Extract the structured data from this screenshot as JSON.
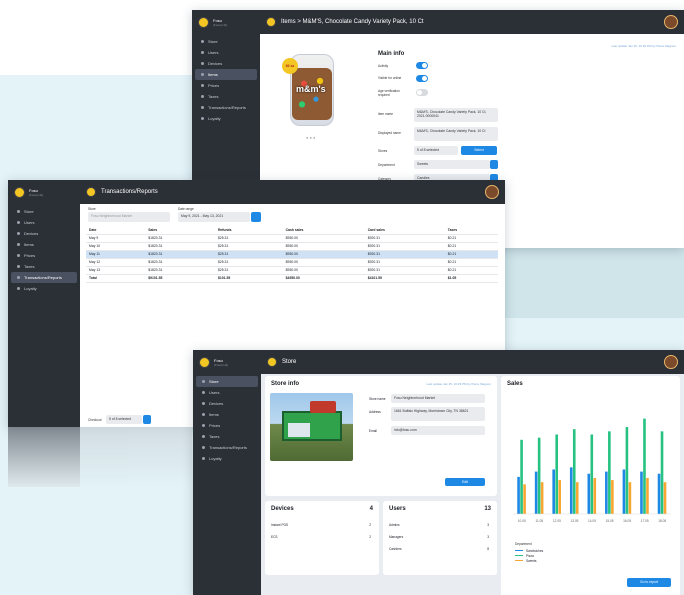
{
  "brand": {
    "name": "Fosu",
    "subtitle": "(Fosu) HQ"
  },
  "nav_item_window": {
    "items": [
      "Store",
      "Users",
      "Devices",
      "Items",
      "Prices",
      "Taxes",
      "Transactions/Reports",
      "Loyalty"
    ]
  },
  "nav_tx_window": {
    "items": [
      "Store",
      "Users",
      "Devices",
      "Items",
      "Prices",
      "Taxes",
      "Transactions/Reports",
      "Loyalty"
    ]
  },
  "nav_store_window": {
    "items": [
      "Store",
      "Users",
      "Devices",
      "Items",
      "Prices",
      "Taxes",
      "Transactions/Reports",
      "Loyalty"
    ]
  },
  "item_window": {
    "title": "Items > M&M'S, Chocolate Candy Variety Pack, 10 Ct",
    "last_update": "Last update Jan 25, 10:29 PM by Pierre Magnon",
    "section": "Main info",
    "labels": {
      "activity": "Activity",
      "visible": "Visible for online",
      "age": "Age verification required",
      "item_name": "Item name",
      "displayed_name": "Displayed name",
      "stores": "Stores",
      "department": "Department",
      "category": "Category"
    },
    "values": {
      "item_name": "M&M'S, Chocolate Candy Variety Pack, 10 Ct, 2021-0000041",
      "displayed_name": "M&M'S, Chocolate Candy Variety Pack, 10 Ct",
      "stores": "5 of 8 selected",
      "department": "Sweets",
      "category": "Candies"
    },
    "select_btn": "Select",
    "product_badge": "62 oz",
    "product_label": "m&m's"
  },
  "tx_window": {
    "title": "Transactions/Reports",
    "store_label": "Store",
    "store_value": "Fosu Neighborhood Market",
    "range_label": "Date range",
    "range_value": "May 9, 2021 - May 13, 2021",
    "columns": [
      "Date",
      "Sales",
      "Refunds",
      "Cash sales",
      "Card sales",
      "Taxes"
    ],
    "rows": [
      [
        "May 9",
        "$1820.31",
        "$25.31",
        "$950.00",
        "$920.31",
        "$0.21"
      ],
      [
        "May 10",
        "$1820.31",
        "$25.31",
        "$950.00",
        "$920.31",
        "$0.21"
      ],
      [
        "May 11",
        "$1820.31",
        "$25.31",
        "$950.00",
        "$920.31",
        "$0.21"
      ],
      [
        "May 12",
        "$1820.31",
        "$25.31",
        "$950.00",
        "$920.31",
        "$0.21"
      ],
      [
        "May 13",
        "$1820.31",
        "$25.31",
        "$950.00",
        "$920.31",
        "$0.21"
      ],
      [
        "Total",
        "$9101.55",
        "$101.55",
        "$4550.00",
        "$4101.55",
        "$1.05"
      ]
    ],
    "selected_row": 2,
    "checkout_label": "Checkout",
    "checkout_value": "5 of 8 selected"
  },
  "store_window": {
    "title": "Store",
    "info_title": "Store info",
    "last_update": "Last update Jan 25, 10:29 PM by Pierre Magnon",
    "fields": [
      {
        "label": "Store name",
        "value": "Fosu Neighborhood Market"
      },
      {
        "label": "Address",
        "value": "1661 Buffalo Highway, Morristown City, TN 38621"
      },
      {
        "label": "Email",
        "value": "info@fosu.com"
      }
    ],
    "edit_btn": "Edit",
    "devices": {
      "title": "Devices",
      "count": "4",
      "rows": [
        {
          "name": "Instant POS",
          "value": "2"
        },
        {
          "name": "ECS",
          "value": "2"
        }
      ]
    },
    "users": {
      "title": "Users",
      "count": "13",
      "rows": [
        {
          "name": "Admins",
          "value": "3"
        },
        {
          "name": "Managers",
          "value": "3"
        },
        {
          "name": "Cashiers",
          "value": "8"
        }
      ]
    },
    "sales_title": "Sales",
    "report_btn": "Go to report"
  },
  "chart_data": {
    "type": "bar",
    "title": "Sales",
    "categories": [
      "10.05",
      "11.05",
      "12.05",
      "13.05",
      "14.05",
      "15.05",
      "16.05",
      "17.05",
      "18.05"
    ],
    "series": [
      {
        "name": "Sandwiches",
        "color": "#1e88e5",
        "values": [
          35,
          40,
          42,
          44,
          38,
          40,
          42,
          40,
          38
        ]
      },
      {
        "name": "Pizza",
        "color": "#26c281",
        "values": [
          70,
          72,
          75,
          80,
          75,
          78,
          82,
          90,
          78
        ]
      },
      {
        "name": "Sweets",
        "color": "#f7a731",
        "values": [
          28,
          30,
          32,
          30,
          34,
          32,
          30,
          34,
          30
        ]
      }
    ],
    "legend_title": "Department",
    "ylim": [
      0,
      100
    ]
  },
  "colors": {
    "sidebar": "#2b2f36",
    "accent": "#1e88e5",
    "background": "#e3f3f7"
  }
}
